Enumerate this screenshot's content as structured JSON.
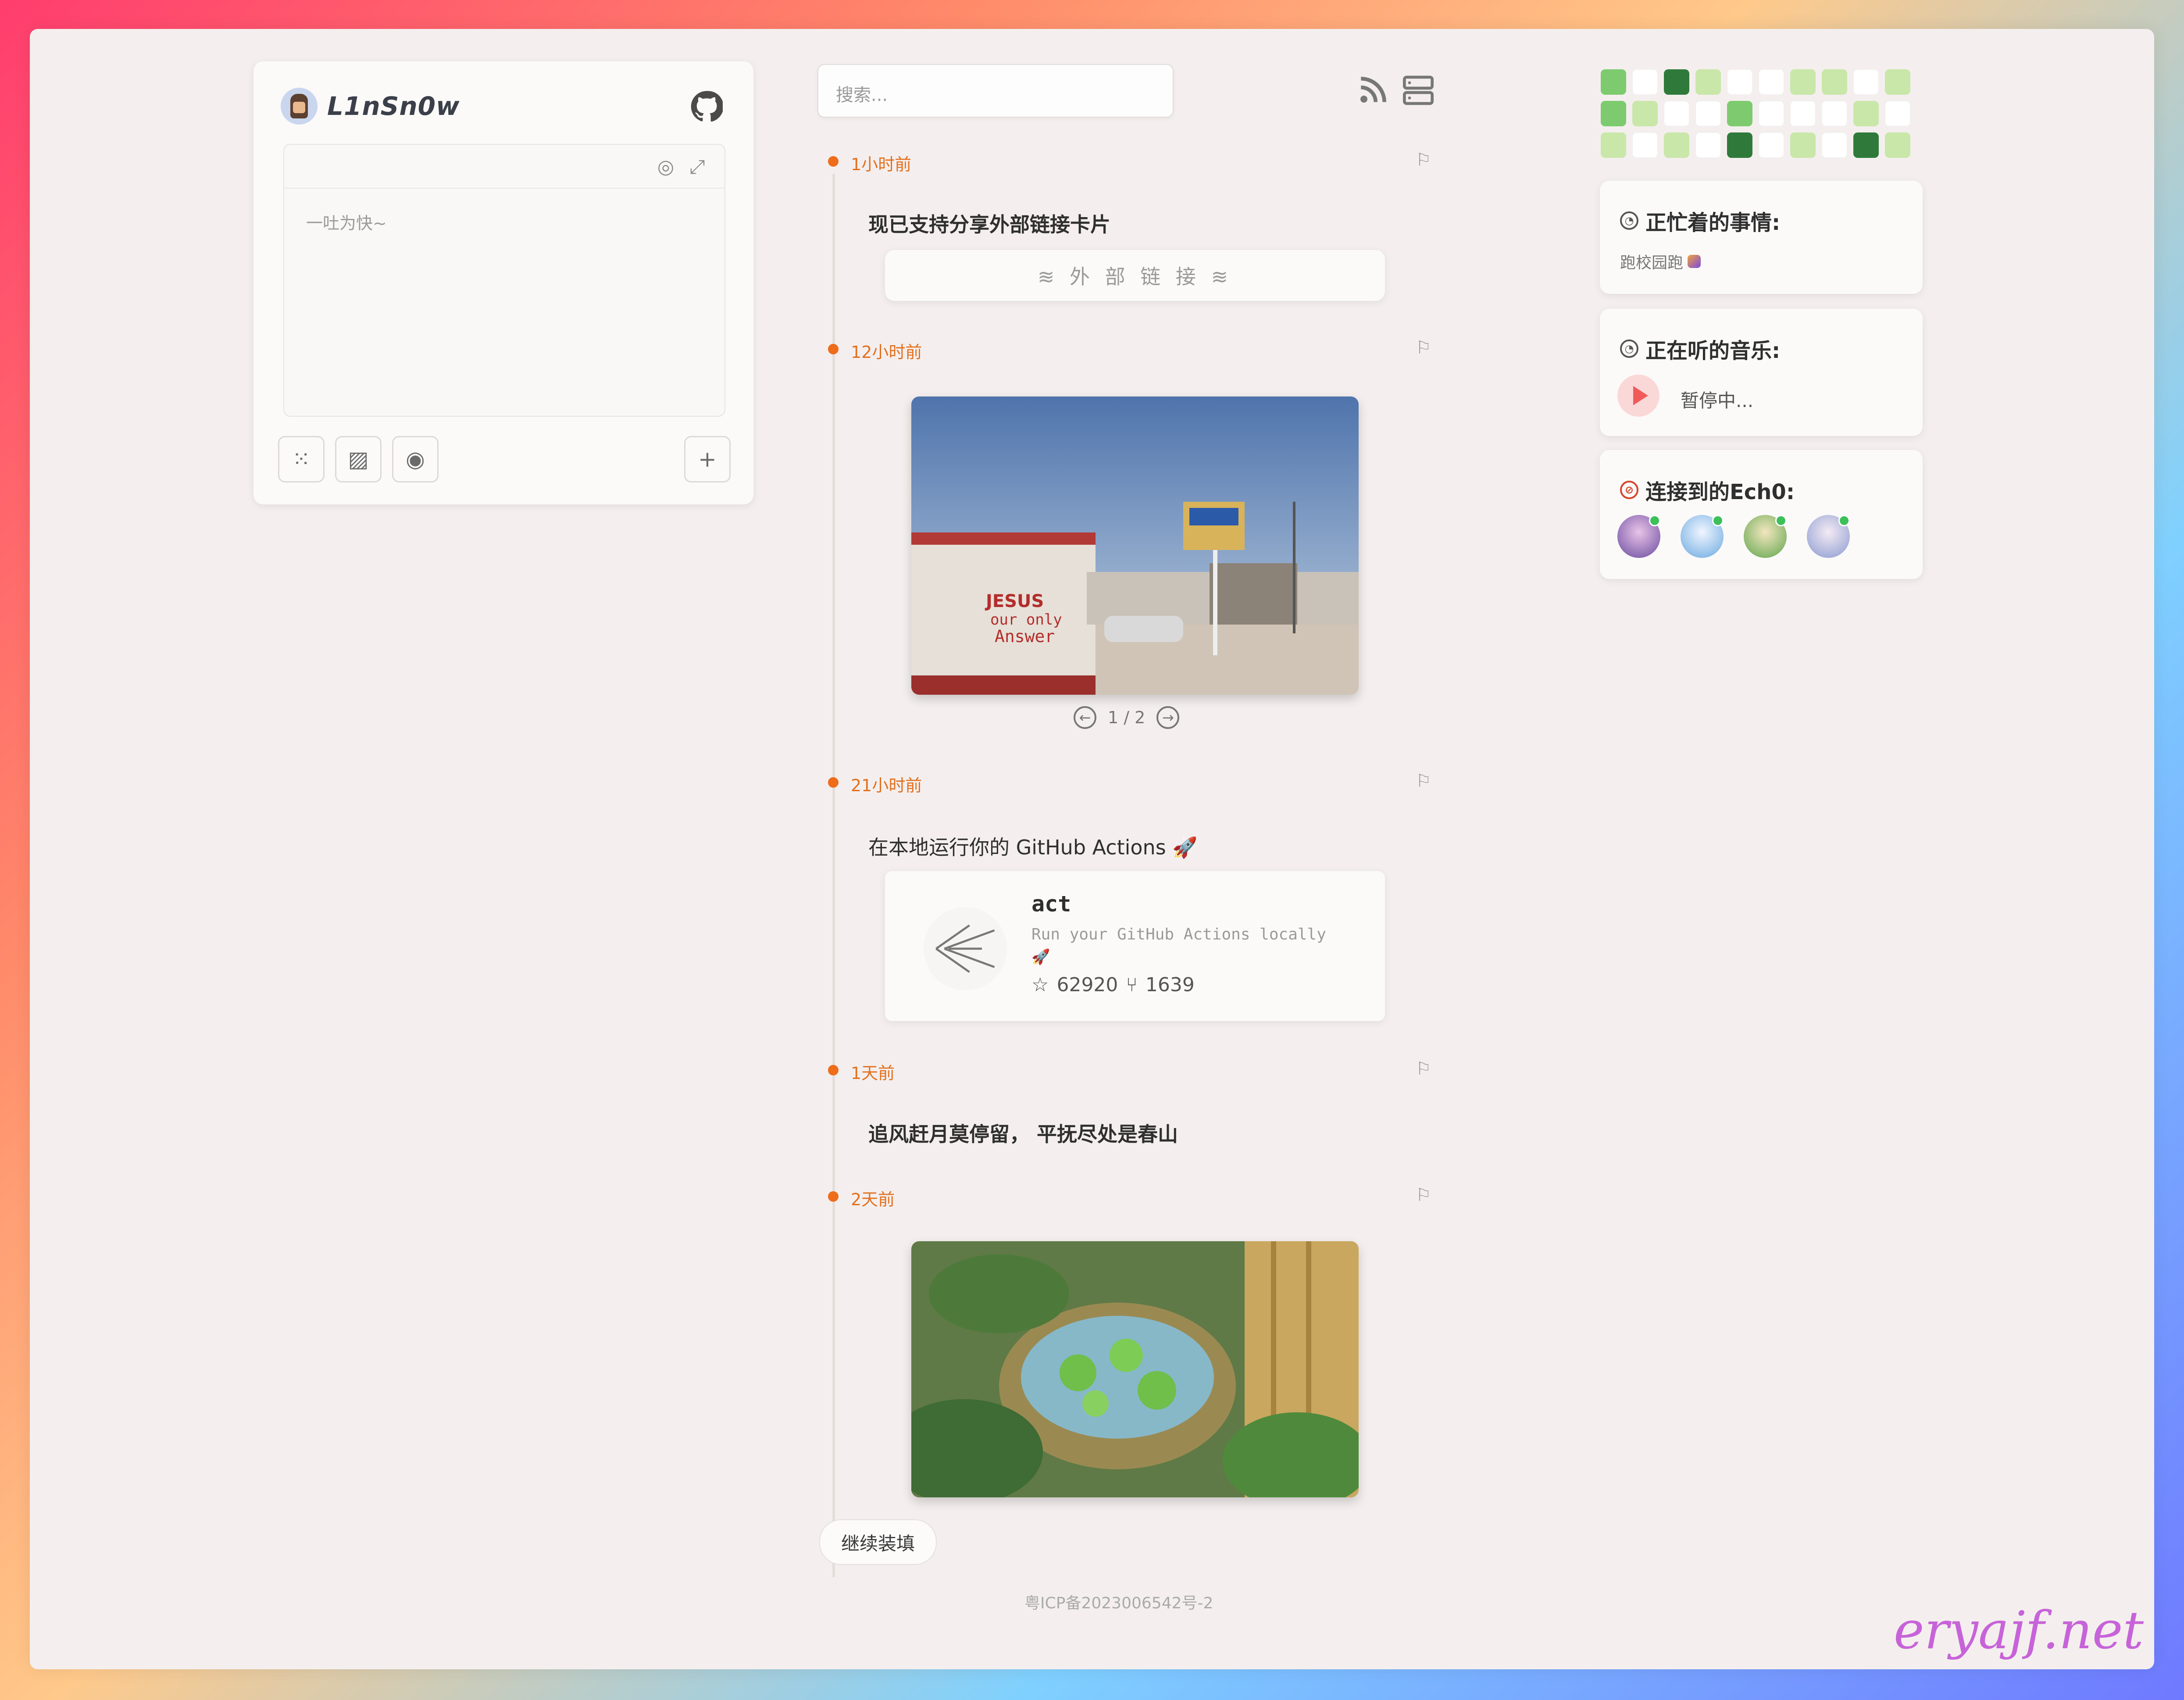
{
  "user": {
    "name": "L1nSn0w"
  },
  "editor": {
    "placeholder": "一吐为快~"
  },
  "search": {
    "placeholder": "搜索..."
  },
  "posts": [
    {
      "time": "1小时前",
      "text": "现已支持分享外部链接卡片",
      "link_label": "≋ 外 部 链 接 ≋"
    },
    {
      "time": "12小时前",
      "pager": "1 / 2"
    },
    {
      "time": "21小时前",
      "text": "在本地运行你的 GitHub Actions 🚀",
      "repo": {
        "name": "act",
        "desc": "Run your GitHub Actions locally",
        "desc_emoji": "🚀",
        "stars": "62920",
        "forks": "1639"
      }
    },
    {
      "time": "1天前",
      "text": "追风赶月莫停留，  平抚尽处是春山"
    },
    {
      "time": "2天前"
    }
  ],
  "load_more": "继续装填",
  "icp": "粤ICP备2023006542号-2",
  "heatmap": [
    [
      2,
      0,
      3,
      1,
      0,
      0,
      1,
      1,
      0,
      1
    ],
    [
      2,
      1,
      0,
      0,
      2,
      0,
      0,
      0,
      1,
      0
    ],
    [
      1,
      0,
      1,
      0,
      3,
      0,
      1,
      0,
      3,
      1
    ]
  ],
  "heat_colors": [
    "#ffffff",
    "#c9e7a9",
    "#7dcb6e",
    "#2f7a3b"
  ],
  "busy": {
    "title": "正忙着的事情:",
    "text": "跑校园跑"
  },
  "music": {
    "title": "正在听的音乐:",
    "status": "暂停中..."
  },
  "echo": {
    "title": "连接到的Ech0:"
  },
  "watermark": "eryajf.net"
}
